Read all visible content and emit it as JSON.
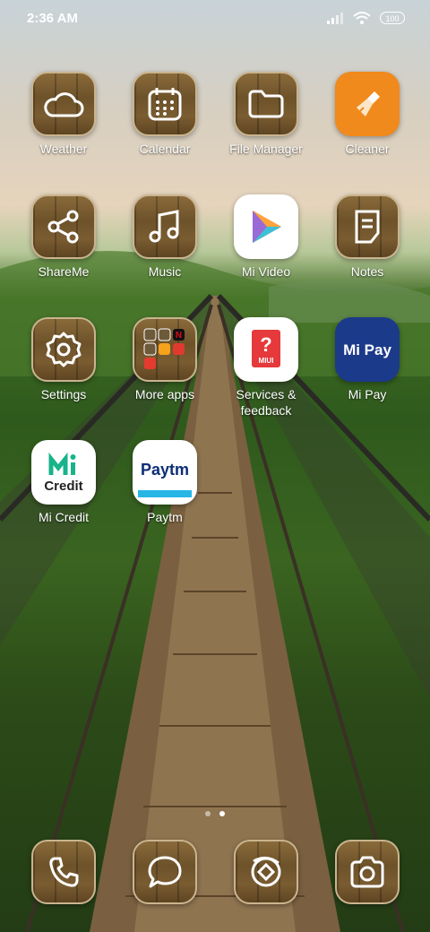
{
  "status_bar": {
    "time": "2:36 AM",
    "battery": "100"
  },
  "apps": [
    {
      "label": "Weather",
      "icon": "cloud-icon"
    },
    {
      "label": "Calendar",
      "icon": "calendar-icon"
    },
    {
      "label": "File Manager",
      "icon": "folder-icon"
    },
    {
      "label": "Cleaner",
      "icon": "broom-icon"
    },
    {
      "label": "ShareMe",
      "icon": "share-icon"
    },
    {
      "label": "Music",
      "icon": "music-note-icon"
    },
    {
      "label": "Mi Video",
      "icon": "play-icon"
    },
    {
      "label": "Notes",
      "icon": "notes-icon"
    },
    {
      "label": "Settings",
      "icon": "gear-icon"
    },
    {
      "label": "More apps",
      "icon": "app-folder-icon"
    },
    {
      "label": "Services & feedback",
      "icon": "question-icon",
      "badge": "MIUI"
    },
    {
      "label": "Mi Pay",
      "icon": "mipay-icon",
      "logo_text": "Mi Pay"
    },
    {
      "label": "Mi Credit",
      "icon": "micredit-icon",
      "logo_text": "Credit"
    },
    {
      "label": "Paytm",
      "icon": "paytm-icon",
      "logo_text": "Paytm"
    }
  ],
  "dock": [
    {
      "icon": "phone-icon"
    },
    {
      "icon": "message-icon"
    },
    {
      "icon": "browser-icon"
    },
    {
      "icon": "camera-icon"
    }
  ],
  "page_indicator": {
    "pages": 2,
    "current": 2
  },
  "colors": {
    "cleaner_orange": "#f08a1c",
    "mipay_blue": "#1c3a8a",
    "micredit_green": "#18b38a",
    "paytm_blue": "#0c2e76",
    "paytm_light": "#27b6e6"
  }
}
